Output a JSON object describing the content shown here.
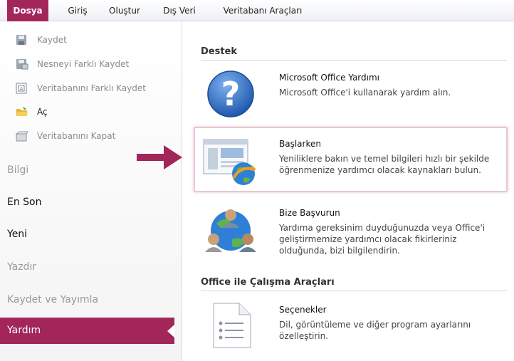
{
  "ribbon": {
    "tabs": [
      {
        "label": "Dosya"
      },
      {
        "label": "Giriş"
      },
      {
        "label": "Oluştur"
      },
      {
        "label": "Dış Veri"
      },
      {
        "label": "Veritabanı Araçları"
      }
    ]
  },
  "sidebar": {
    "commands": [
      {
        "label": "Kaydet",
        "icon": "save-icon"
      },
      {
        "label": "Nesneyi Farklı Kaydet",
        "icon": "save-object-as-icon"
      },
      {
        "label": "Veritabanını Farklı Kaydet",
        "icon": "save-database-as-icon"
      },
      {
        "label": "Aç",
        "icon": "open-folder-icon"
      },
      {
        "label": "Veritabanını Kapat",
        "icon": "close-database-icon"
      }
    ],
    "nav": [
      {
        "label": "Bilgi"
      },
      {
        "label": "En Son"
      },
      {
        "label": "Yeni"
      },
      {
        "label": "Yazdır"
      },
      {
        "label": "Kaydet ve Yayımla"
      },
      {
        "label": "Yardım"
      }
    ]
  },
  "main": {
    "support_heading": "Destek",
    "items": [
      {
        "title": "Microsoft Office Yardımı",
        "desc": "Microsoft Office'i kullanarak yardım alın.",
        "icon": "help-question-icon"
      },
      {
        "title": "Başlarken",
        "desc_lines": [
          "Yeniliklere bakın ve temel bilgileri hızlı bir şekilde",
          "öğrenmenize yardımcı olacak kaynakları bulun."
        ],
        "icon": "getting-started-icon"
      },
      {
        "title": "Bize Başvurun",
        "desc_lines": [
          "Yardıma gereksinim duyduğunuzda veya Office'i",
          "geliştirmemize yardımcı olacak fikirleriniz",
          "olduğunda, bizi bilgilendirin."
        ],
        "icon": "contact-us-icon"
      }
    ],
    "tools_heading": "Office ile Çalışma Araçları",
    "tools": [
      {
        "title": "Seçenekler",
        "desc_lines": [
          "Dil, görüntüleme ve diğer program ayarlarını",
          "özelleştirin."
        ],
        "icon": "options-icon"
      }
    ]
  },
  "colors": {
    "accent": "#a2265a",
    "help_blue": "#2f6fc4"
  }
}
